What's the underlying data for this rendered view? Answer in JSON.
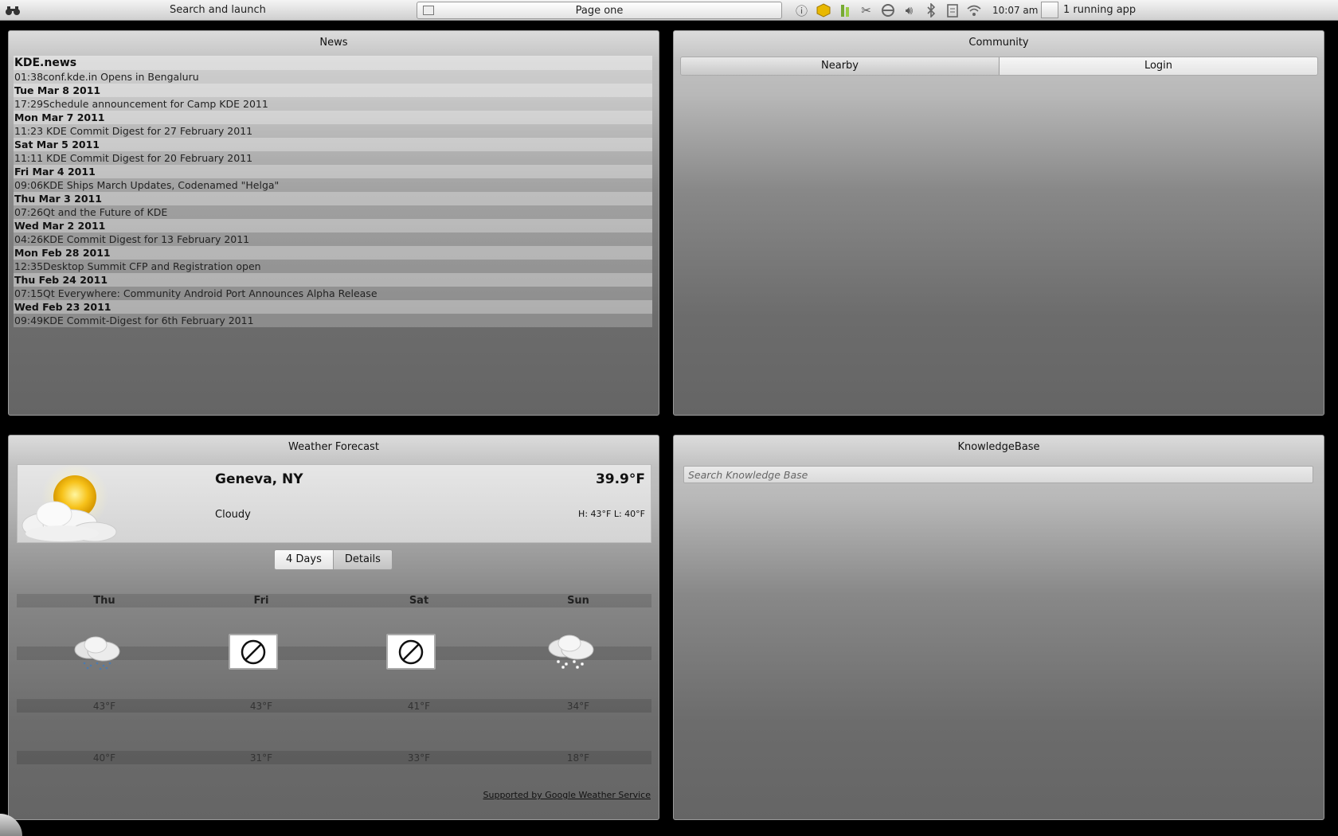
{
  "top_panel": {
    "launcher_icon": "binoculars-icon",
    "launcher_label": "Search and launch",
    "page_icon": "page-icon",
    "page_label": "Page one",
    "tray_icons": [
      "info-icon",
      "updates-icon",
      "battery-icon",
      "scissors-icon",
      "network-icon",
      "volume-icon",
      "bluetooth-icon",
      "clipboard-icon",
      "wifi-icon"
    ],
    "clock": "10:07 am",
    "running_apps": "1 running app"
  },
  "news": {
    "title": "News",
    "rows": [
      {
        "type": "source",
        "text": "KDE.news"
      },
      {
        "type": "item",
        "time": "01:38",
        "title": "conf.kde.in Opens in Bengaluru"
      },
      {
        "type": "date",
        "text": "Tue Mar 8 2011"
      },
      {
        "type": "item",
        "time": "17:29",
        "title": "Schedule announcement for Camp KDE 2011"
      },
      {
        "type": "date",
        "text": "Mon Mar 7 2011"
      },
      {
        "type": "item",
        "time": "11:23",
        "title": " KDE Commit Digest for 27 February 2011"
      },
      {
        "type": "date",
        "text": "Sat Mar 5 2011"
      },
      {
        "type": "item",
        "time": "11:11",
        "title": " KDE Commit Digest for 20 February 2011"
      },
      {
        "type": "date",
        "text": "Fri Mar 4 2011"
      },
      {
        "type": "item",
        "time": "09:06",
        "title": "KDE Ships March Updates, Codenamed \"Helga\""
      },
      {
        "type": "date",
        "text": "Thu Mar 3 2011"
      },
      {
        "type": "item",
        "time": "07:26",
        "title": "Qt and the Future of KDE"
      },
      {
        "type": "date",
        "text": "Wed Mar 2 2011"
      },
      {
        "type": "item",
        "time": "04:26",
        "title": "KDE Commit Digest for 13 February 2011"
      },
      {
        "type": "date",
        "text": "Mon Feb 28 2011"
      },
      {
        "type": "item",
        "time": "12:35",
        "title": "Desktop Summit CFP and Registration open"
      },
      {
        "type": "date",
        "text": "Thu Feb 24 2011"
      },
      {
        "type": "item",
        "time": "07:15",
        "title": "Qt Everywhere: Community Android Port Announces Alpha Release"
      },
      {
        "type": "date",
        "text": "Wed Feb 23 2011"
      },
      {
        "type": "item",
        "time": "09:49",
        "title": "KDE Commit-Digest for 6th February 2011"
      }
    ]
  },
  "community": {
    "title": "Community",
    "tabs": [
      {
        "label": "Nearby",
        "active": true
      },
      {
        "label": "Login",
        "active": false
      }
    ]
  },
  "weather": {
    "title": "Weather Forecast",
    "current": {
      "location": "Geneva, NY",
      "temperature": "39.9°F",
      "condition": "Cloudy",
      "hilo": "H: 43°F L: 40°F",
      "icon": "partly-cloudy-sun-icon"
    },
    "tabs": [
      {
        "label": "4 Days",
        "active": true
      },
      {
        "label": "Details",
        "active": false
      }
    ],
    "days": [
      {
        "name": "Thu",
        "icon": "rain-cloud-icon",
        "high": "43°F",
        "low": "40°F"
      },
      {
        "name": "Fri",
        "icon": "not-available-icon",
        "high": "43°F",
        "low": "31°F"
      },
      {
        "name": "Sat",
        "icon": "not-available-icon",
        "high": "41°F",
        "low": "33°F"
      },
      {
        "name": "Sun",
        "icon": "snow-cloud-icon",
        "high": "34°F",
        "low": "18°F"
      }
    ],
    "credit": "Supported by Google Weather Service"
  },
  "knowledgebase": {
    "title": "KnowledgeBase",
    "search_placeholder": "Search Knowledge Base",
    "search_value": ""
  },
  "colors": {
    "panel_top": "#dcdcdc",
    "panel_bottom": "#656565",
    "desktop_bg": "#000000"
  }
}
